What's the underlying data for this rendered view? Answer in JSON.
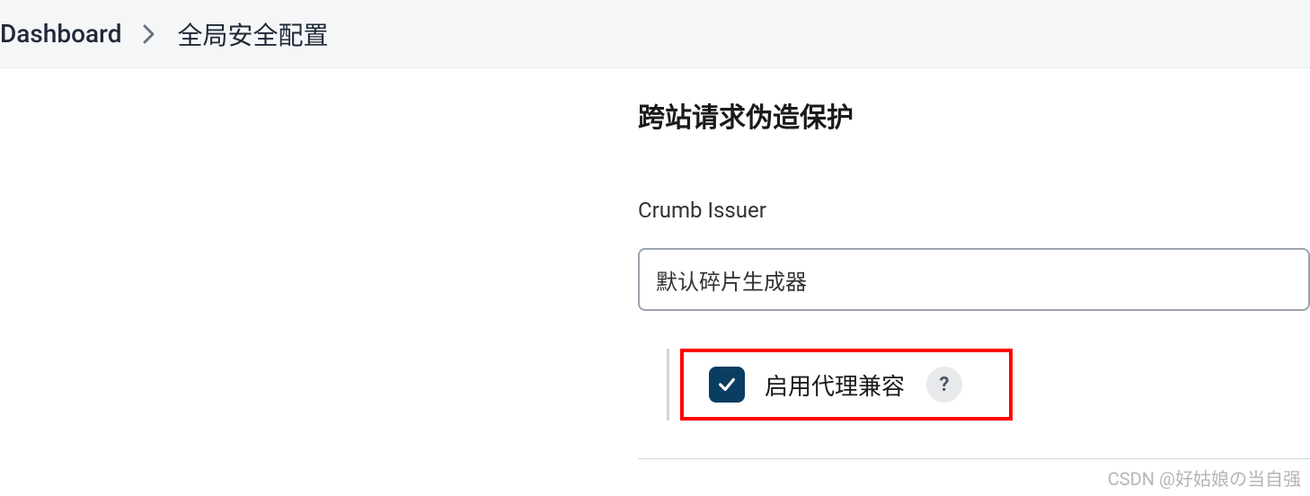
{
  "breadcrumb": {
    "items": [
      {
        "label": "Dashboard"
      },
      {
        "label": "全局安全配置"
      }
    ]
  },
  "section": {
    "title": "跨站请求伪造保护"
  },
  "crumb_issuer": {
    "label": "Crumb Issuer",
    "selected": "默认碎片生成器"
  },
  "proxy_compat": {
    "label": "启用代理兼容",
    "checked": true,
    "help": "?"
  },
  "watermark": "CSDN @好姑娘の当自强"
}
